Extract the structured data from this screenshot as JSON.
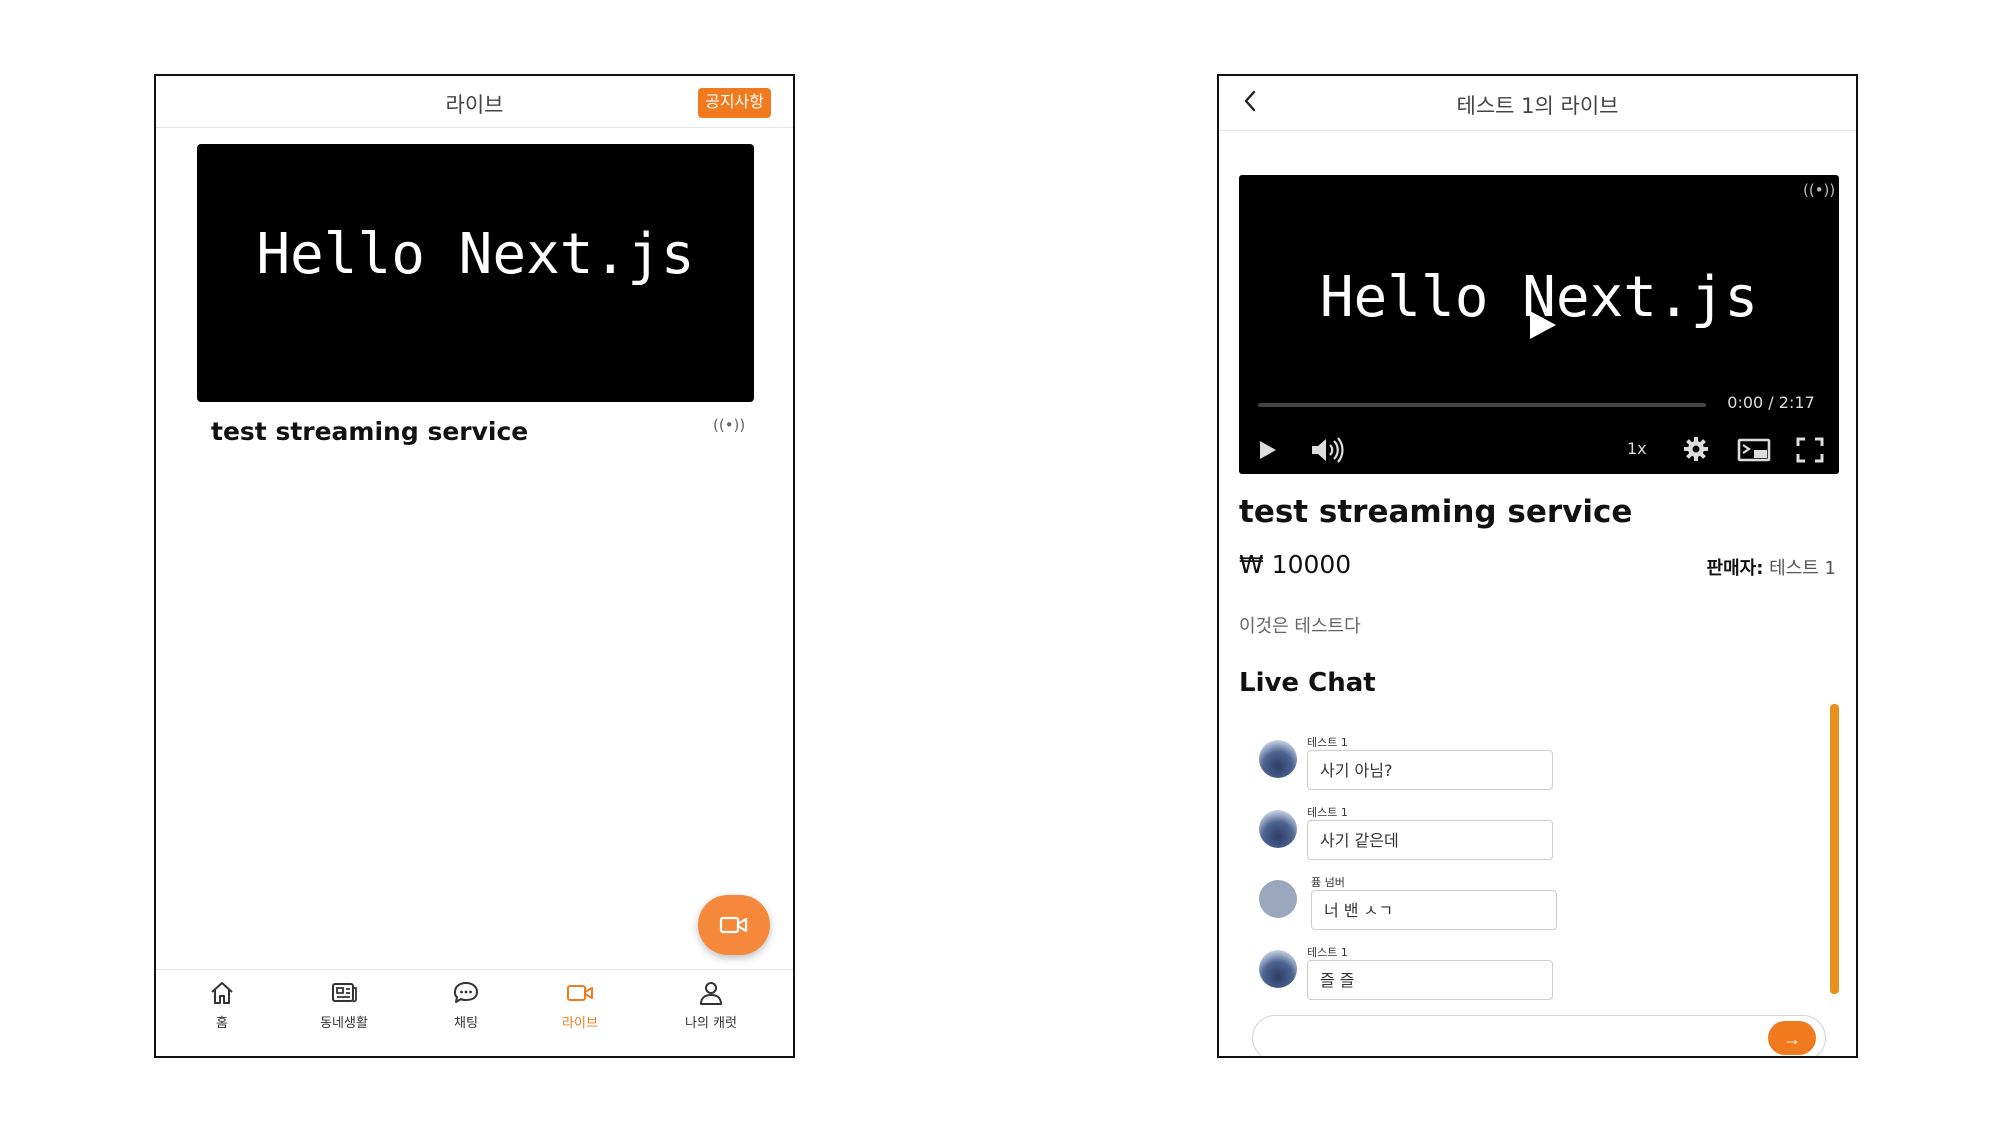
{
  "left_screen": {
    "header": {
      "title": "라이브",
      "notice_button": "공지사항"
    },
    "stream_card": {
      "thumbnail_text": "Hello Next.js",
      "title": "test streaming service",
      "live_icon": "((•))"
    },
    "fab": {
      "icon": "video-camera-icon"
    },
    "bottom_nav": {
      "items": [
        {
          "label": "홈",
          "icon": "home-icon",
          "active": false
        },
        {
          "label": "동네생활",
          "icon": "newspaper-icon",
          "active": false
        },
        {
          "label": "채팅",
          "icon": "chat-bubble-icon",
          "active": false
        },
        {
          "label": "라이브",
          "icon": "video-camera-icon",
          "active": true
        },
        {
          "label": "나의 캐럿",
          "icon": "user-icon",
          "active": false
        }
      ]
    }
  },
  "right_screen": {
    "header": {
      "back_icon": "chevron-left-icon",
      "title": "테스트 1의 라이브"
    },
    "player": {
      "video_text": "Hello Next.js",
      "live_icon": "((•))",
      "time": "0:00 / 2:17",
      "speed": "1x",
      "progress": 0
    },
    "stream": {
      "title": "test streaming service",
      "price": "₩ 10000",
      "seller_label": "판매자:",
      "seller_name": "테스트 1",
      "description": "이것은 테스트다"
    },
    "chat": {
      "heading": "Live Chat",
      "messages": [
        {
          "sender": "테스트 1",
          "text": "사기 아님?",
          "avatar": "image"
        },
        {
          "sender": "테스트 1",
          "text": "사기 같은데",
          "avatar": "image"
        },
        {
          "sender": "퓸 넘버",
          "text": "너 밴 ㅅㄱ",
          "avatar": "plain"
        },
        {
          "sender": "테스트 1",
          "text": "즐 즐",
          "avatar": "image"
        }
      ],
      "input_placeholder": "",
      "send_icon": "→"
    }
  },
  "colors": {
    "accent": "#f07a1e",
    "scrollbar": "#e8901c"
  }
}
